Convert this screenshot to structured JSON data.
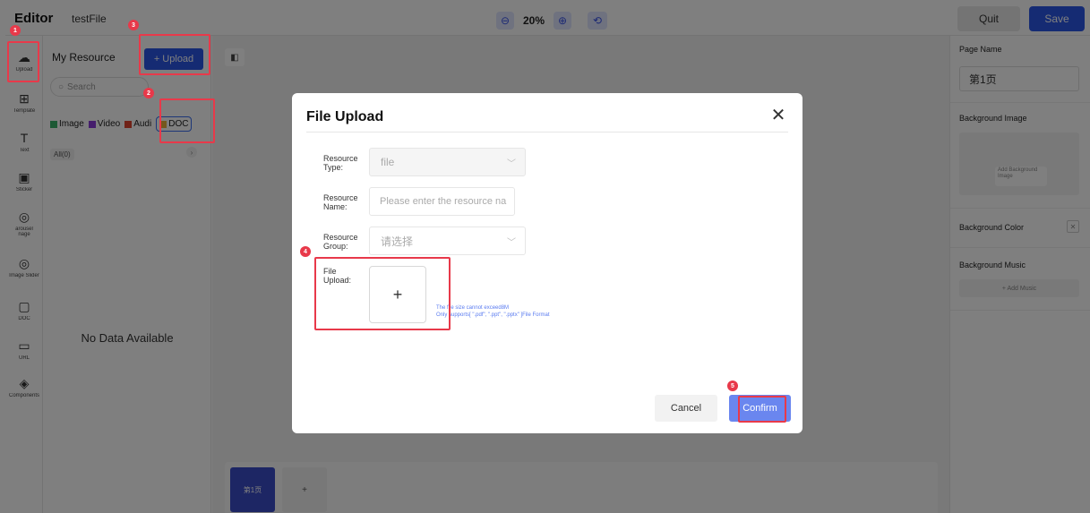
{
  "topbar": {
    "app_title": "Editor",
    "file_name": "testFile",
    "zoom_level": "20%",
    "zoom_out_icon": "⊖",
    "zoom_in_icon": "⊕",
    "undo_icon": "⟲",
    "quit_label": "Quit",
    "save_label": "Save"
  },
  "sidebar": {
    "items": [
      {
        "label": "Upload",
        "icon": "☁"
      },
      {
        "label": "Template",
        "icon": "⊞"
      },
      {
        "label": "Text",
        "icon": "T"
      },
      {
        "label": "Sticker",
        "icon": "▣"
      },
      {
        "label": "arousel\nnage",
        "icon": "◎"
      },
      {
        "label": "Image Slider",
        "icon": "◎"
      },
      {
        "label": "DOC",
        "icon": "▢"
      },
      {
        "label": "URL",
        "icon": "▭"
      },
      {
        "label": "Components",
        "icon": "◈"
      }
    ]
  },
  "resource_panel": {
    "title": "My Resource",
    "upload_label": "+ Upload",
    "search_placeholder": "Search",
    "types": [
      "Image",
      "Video",
      "Audi",
      "DOC"
    ],
    "type_colors": [
      "#3bb36b",
      "#8a3ad9",
      "#e0442e",
      "#e8b13a"
    ],
    "filter_label": "All(0)",
    "no_data": "No Data Available"
  },
  "canvas": {
    "page_label": "第1页",
    "add_page_label": "+"
  },
  "right_panel": {
    "page_name_label": "Page Name",
    "page_name_value": "第1页",
    "bg_image_label": "Background Image",
    "add_bg_image_label": "Add Background Image",
    "bg_color_label": "Background Color",
    "bg_music_label": "Background Music",
    "add_music_label": "+ Add Music"
  },
  "modal": {
    "title": "File Upload",
    "close_icon": "✕",
    "resource_type_label": "Resource Type:",
    "resource_type_value": "file",
    "resource_name_label": "Resource Name:",
    "resource_name_placeholder": "Please enter the resource na",
    "resource_group_label": "Resource Group:",
    "resource_group_placeholder": "请选择",
    "file_upload_label": "File Upload:",
    "upload_plus": "+",
    "hint_line1": "The file size cannot exceed8M",
    "hint_line2": "Only supports[ \".pdf\", \".ppt\", \".pptx\" ]File Format",
    "cancel_label": "Cancel",
    "confirm_label": "Confirm"
  },
  "steps": [
    "1",
    "2",
    "3",
    "4",
    "5"
  ],
  "colors": {
    "accent": "#2b56e6",
    "annotation": "#e8394a",
    "confirm": "#6a86ef"
  }
}
